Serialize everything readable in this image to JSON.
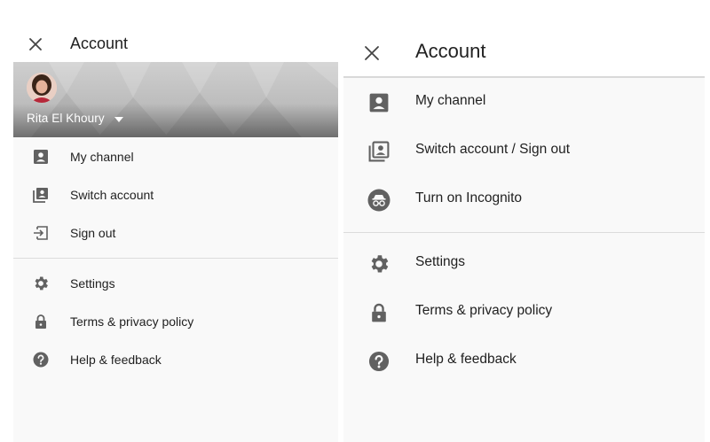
{
  "left_panel": {
    "title": "Account",
    "account_name": "Rita El Khoury",
    "items_primary": [
      {
        "label": "My channel",
        "icon": "account-box-icon"
      },
      {
        "label": "Switch account",
        "icon": "switch-account-icon"
      },
      {
        "label": "Sign out",
        "icon": "sign-out-icon"
      }
    ],
    "items_secondary": [
      {
        "label": "Settings",
        "icon": "gear-icon"
      },
      {
        "label": "Terms & privacy policy",
        "icon": "lock-icon"
      },
      {
        "label": "Help & feedback",
        "icon": "help-icon"
      }
    ]
  },
  "right_panel": {
    "title": "Account",
    "items_primary": [
      {
        "label": "My channel",
        "icon": "account-box-icon"
      },
      {
        "label": "Switch account / Sign out",
        "icon": "switch-account-icon"
      },
      {
        "label": "Turn on Incognito",
        "icon": "incognito-icon"
      }
    ],
    "items_secondary": [
      {
        "label": "Settings",
        "icon": "gear-icon"
      },
      {
        "label": "Terms & privacy policy",
        "icon": "lock-icon"
      },
      {
        "label": "Help & feedback",
        "icon": "help-icon"
      }
    ]
  },
  "colors": {
    "icon_gray": "#616161",
    "text": "#212121",
    "panel_bg": "#f9f9f9",
    "divider": "#dcdcdc"
  }
}
